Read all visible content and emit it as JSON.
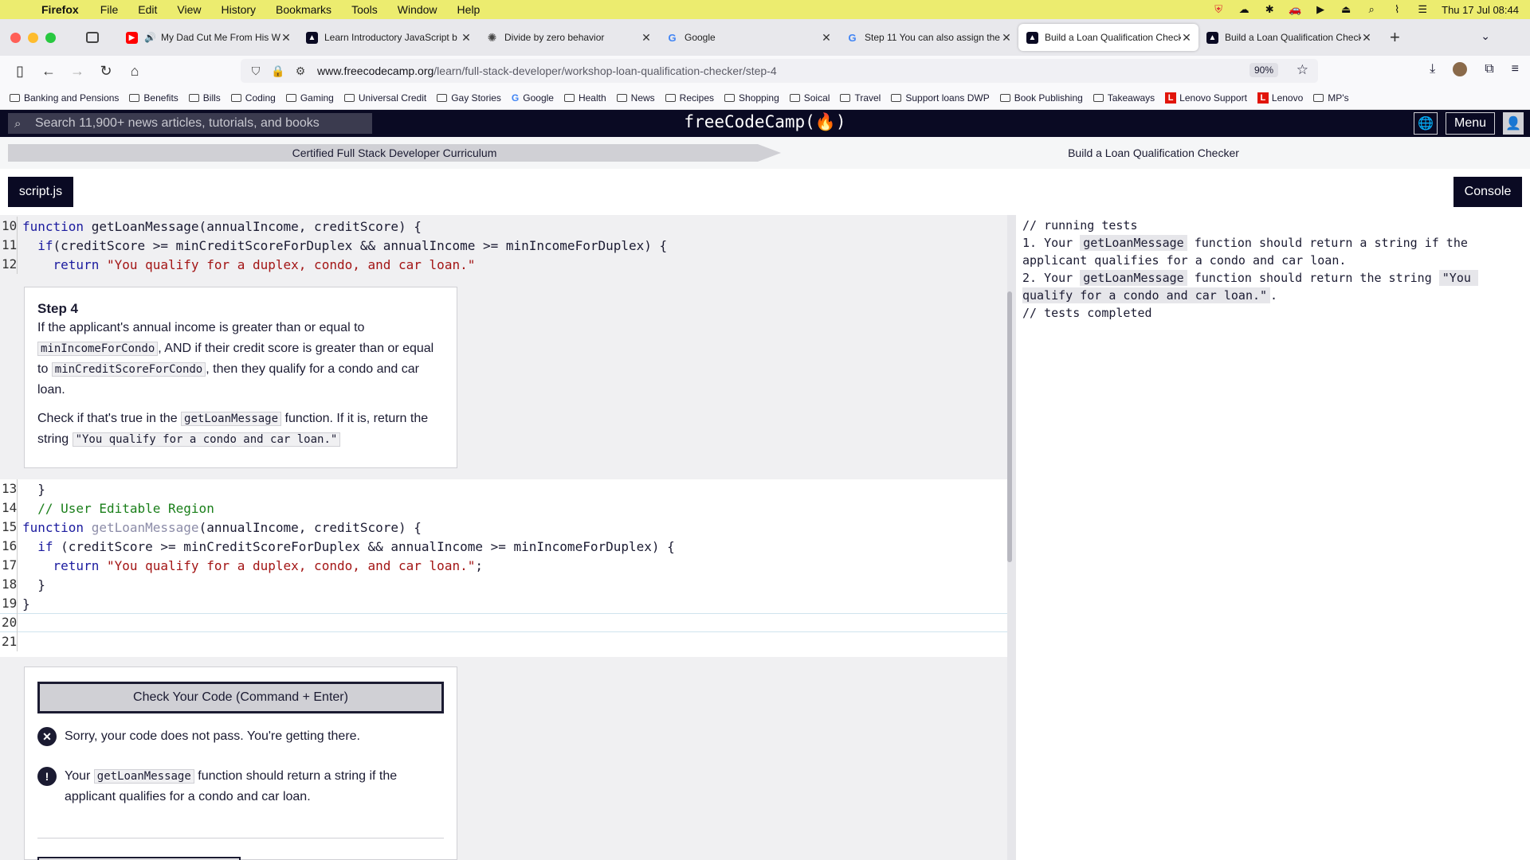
{
  "menubar": {
    "app": "Firefox",
    "items": [
      "File",
      "Edit",
      "View",
      "History",
      "Bookmarks",
      "Tools",
      "Window",
      "Help"
    ],
    "clock": "Thu 17 Jul  08:44"
  },
  "tabs": [
    {
      "title": "My Dad Cut Me From His W",
      "icon": "youtube-icon",
      "color": "#ff0000",
      "active": false
    },
    {
      "title": "Learn Introductory JavaScript b",
      "icon": "fcc-icon",
      "color": "#0a0a23",
      "active": false
    },
    {
      "title": "Divide by zero behavior",
      "icon": "openai-icon",
      "color": "#555555",
      "active": false
    },
    {
      "title": "Google",
      "icon": "google-icon",
      "color": "#4285f4",
      "active": false
    },
    {
      "title": "Step 11 You can also assign the",
      "icon": "google-icon",
      "color": "#4285f4",
      "active": false
    },
    {
      "title": "Build a Loan Qualification Check",
      "icon": "fcc-icon",
      "color": "#0a0a23",
      "active": true
    },
    {
      "title": "Build a Loan Qualification Check",
      "icon": "fcc-icon",
      "color": "#0a0a23",
      "active": false
    }
  ],
  "navbar": {
    "url_host": "www.freecodecamp.org",
    "url_path": "/learn/full-stack-developer/workshop-loan-qualification-checker/step-4",
    "zoom": "90%"
  },
  "bookmarks": [
    {
      "label": "Banking and Pensions",
      "type": "folder"
    },
    {
      "label": "Benefits",
      "type": "folder"
    },
    {
      "label": "Bills",
      "type": "folder"
    },
    {
      "label": "Coding",
      "type": "folder"
    },
    {
      "label": "Gaming",
      "type": "folder"
    },
    {
      "label": "Universal Credit",
      "type": "folder"
    },
    {
      "label": "Gay Stories",
      "type": "folder"
    },
    {
      "label": "Google",
      "type": "google"
    },
    {
      "label": "Health",
      "type": "folder"
    },
    {
      "label": "News",
      "type": "folder"
    },
    {
      "label": "Recipes",
      "type": "folder"
    },
    {
      "label": "Shopping",
      "type": "folder"
    },
    {
      "label": "Soical",
      "type": "folder"
    },
    {
      "label": "Travel",
      "type": "folder"
    },
    {
      "label": "Support loans DWP",
      "type": "folder"
    },
    {
      "label": "Book Publishing",
      "type": "folder"
    },
    {
      "label": "Takeaways",
      "type": "folder"
    },
    {
      "label": "Lenovo Support",
      "type": "lenovo"
    },
    {
      "label": "Lenovo",
      "type": "lenovo"
    },
    {
      "label": "MP's",
      "type": "folder"
    }
  ],
  "fcc": {
    "search_placeholder": "Search 11,900+ news articles, tutorials, and books",
    "logo": "freeCodeCamp(🔥)",
    "menu": "Menu"
  },
  "breadcrumb": {
    "curriculum": "Certified Full Stack Developer Curriculum",
    "workshop": "Build a Loan Qualification Checker"
  },
  "editor": {
    "file_tab": "script.js",
    "console_button": "Console"
  },
  "step": {
    "title": "Step 4",
    "p1_a": "If the applicant's annual income is greater than or equal to ",
    "p1_code1": "minIncomeForCondo",
    "p1_b": ", AND if their credit score is greater than or equal to ",
    "p1_code2": "minCreditScoreForCondo",
    "p1_c": ", then they qualify for a condo and car loan.",
    "p2_a": "Check if that's true in the ",
    "p2_code1": "getLoanMessage",
    "p2_b": " function. If it is, return the string ",
    "p2_code2": "\"You qualify for a condo and car loan.\""
  },
  "check": {
    "button": "Check Your Code (Command + Enter)",
    "fail": "Sorry, your code does not pass. You're getting there.",
    "hint_a": "Your ",
    "hint_code": "getLoanMessage",
    "hint_b": " function should return a string if the applicant qualifies for a condo and car loan."
  },
  "console": {
    "line1": "// running tests",
    "t1_a": "1. Your ",
    "t1_code": "getLoanMessage",
    "t1_b": " function should return a string if the applicant qualifies for a condo and car loan.",
    "t2_a": "2. Your ",
    "t2_code": "getLoanMessage",
    "t2_b": " function should return the string ",
    "t2_code2": "\"You qualify for a condo and car loan.\"",
    "t2_c": ".",
    "line_end": "// tests completed"
  },
  "code_lines": {
    "n10": "10",
    "n11": "11",
    "n12": "12",
    "n13": "13",
    "n14": "14",
    "n15": "15",
    "n16": "16",
    "n17": "17",
    "n18": "18",
    "n19": "19",
    "n20": "20",
    "n21": "21"
  }
}
